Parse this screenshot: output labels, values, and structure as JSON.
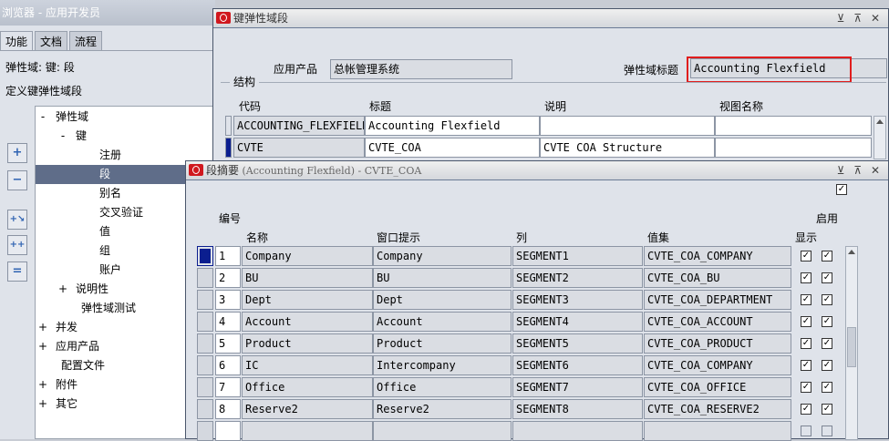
{
  "navigator": {
    "title": "浏览器 - 应用开发员",
    "tabs": [
      "功能",
      "文档",
      "流程"
    ],
    "path_label": "弹性域: 键: 段",
    "action_label": "定义键弹性域段",
    "tree": [
      {
        "mark": "-",
        "label": "弹性域"
      },
      {
        "mark": "-",
        "label": "键"
      },
      {
        "mark": "",
        "label": "注册"
      },
      {
        "mark": "",
        "label": "段"
      },
      {
        "mark": "",
        "label": "别名"
      },
      {
        "mark": "",
        "label": "交叉验证"
      },
      {
        "mark": "",
        "label": "值"
      },
      {
        "mark": "",
        "label": "组"
      },
      {
        "mark": "",
        "label": "账户"
      },
      {
        "mark": "+",
        "label": "说明性"
      },
      {
        "mark": "",
        "label": "弹性域测试"
      },
      {
        "mark": "+",
        "label": "并发"
      },
      {
        "mark": "+",
        "label": "应用产品"
      },
      {
        "mark": "",
        "label": "配置文件"
      },
      {
        "mark": "+",
        "label": "附件"
      },
      {
        "mark": "+",
        "label": "其它"
      }
    ]
  },
  "kff_window": {
    "title": "键弹性域段",
    "controls": "⊻ ⊼ ✕",
    "app_product_label": "应用产品",
    "app_product_value": "总帐管理系统",
    "flex_title_label": "弹性域标题",
    "flex_title_value": "Accounting Flexfield",
    "section_label": "结构",
    "columns": [
      "代码",
      "标题",
      "说明",
      "视图名称"
    ],
    "rows": [
      {
        "code": "ACCOUNTING_FLEXFIELD",
        "title": "Accounting Flexfield",
        "desc": "",
        "view": ""
      },
      {
        "code": "CVTE",
        "title": "CVTE_COA",
        "desc": "CVTE COA Structure",
        "view": ""
      }
    ]
  },
  "seg_window": {
    "title": "段摘要",
    "subtitle": " (Accounting Flexfield) - CVTE_COA",
    "controls": "⊻ ⊼ ✕",
    "hdr_number": "编号",
    "hdr_enabled": "启用",
    "columns": [
      "名称",
      "窗口提示",
      "列",
      "值集",
      "显示"
    ],
    "rows": [
      {
        "num": "1",
        "name": "Company",
        "prompt": "Company",
        "col": "SEGMENT1",
        "vset": "CVTE_COA_COMPANY",
        "display": true,
        "enabled": true
      },
      {
        "num": "2",
        "name": "BU",
        "prompt": "BU",
        "col": "SEGMENT2",
        "vset": "CVTE_COA_BU",
        "display": true,
        "enabled": true
      },
      {
        "num": "3",
        "name": "Dept",
        "prompt": "Dept",
        "col": "SEGMENT3",
        "vset": "CVTE_COA_DEPARTMENT",
        "display": true,
        "enabled": true
      },
      {
        "num": "4",
        "name": "Account",
        "prompt": "Account",
        "col": "SEGMENT4",
        "vset": "CVTE_COA_ACCOUNT",
        "display": true,
        "enabled": true
      },
      {
        "num": "5",
        "name": "Product",
        "prompt": "Product",
        "col": "SEGMENT5",
        "vset": "CVTE_COA_PRODUCT",
        "display": true,
        "enabled": true
      },
      {
        "num": "6",
        "name": "IC",
        "prompt": "Intercompany",
        "col": "SEGMENT6",
        "vset": "CVTE_COA_COMPANY",
        "display": true,
        "enabled": true
      },
      {
        "num": "7",
        "name": "Office",
        "prompt": "Office",
        "col": "SEGMENT7",
        "vset": "CVTE_COA_OFFICE",
        "display": true,
        "enabled": true
      },
      {
        "num": "8",
        "name": "Reserve2",
        "prompt": "Reserve2",
        "col": "SEGMENT8",
        "vset": "CVTE_COA_RESERVE2",
        "display": true,
        "enabled": true
      },
      {
        "num": "",
        "name": "",
        "prompt": "",
        "col": "",
        "vset": "",
        "display": false,
        "enabled": false
      }
    ]
  },
  "colors": {
    "accent_selection": "#5f6d89",
    "current_record": "#0b1e8f",
    "highlight_box": "#e01d1d",
    "window_frame": "#6b7b95"
  }
}
